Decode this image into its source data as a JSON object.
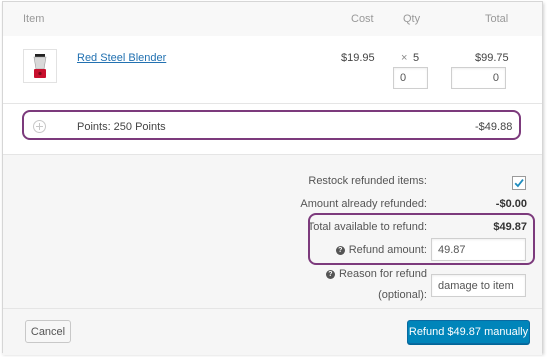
{
  "header": {
    "item": "Item",
    "cost": "Cost",
    "qty": "Qty",
    "total": "Total"
  },
  "line_item": {
    "name": "Red Steel Blender",
    "cost": "$19.95",
    "qty_prefix": "×",
    "qty": "5",
    "total": "$99.75",
    "refund_qty_value": "0",
    "refund_total_value": "0"
  },
  "fee_line": {
    "label": "Points: 250 Points",
    "amount": "-$49.88"
  },
  "refund": {
    "restock_label": "Restock refunded items:",
    "restock_checked": true,
    "already_refunded_label": "Amount already refunded:",
    "already_refunded_value": "-$0.00",
    "available_label": "Total available to refund:",
    "available_value": "$49.87",
    "amount_label": "Refund amount:",
    "amount_value": "49.87",
    "reason_label_line1": "Reason for refund",
    "reason_label_line2": "(optional):",
    "reason_value": "damage to item"
  },
  "actions": {
    "cancel_label": "Cancel",
    "refund_label": "Refund $49.87 manually"
  },
  "colors": {
    "highlight": "#7c3a7c",
    "primary_button": "#0085ba",
    "link": "#2271b1"
  },
  "icons": {
    "product_thumbnail": "blender-image",
    "expand": "plus-circle-icon",
    "help": "question-circle-icon",
    "restock_checkbox": "checkmark-icon"
  }
}
